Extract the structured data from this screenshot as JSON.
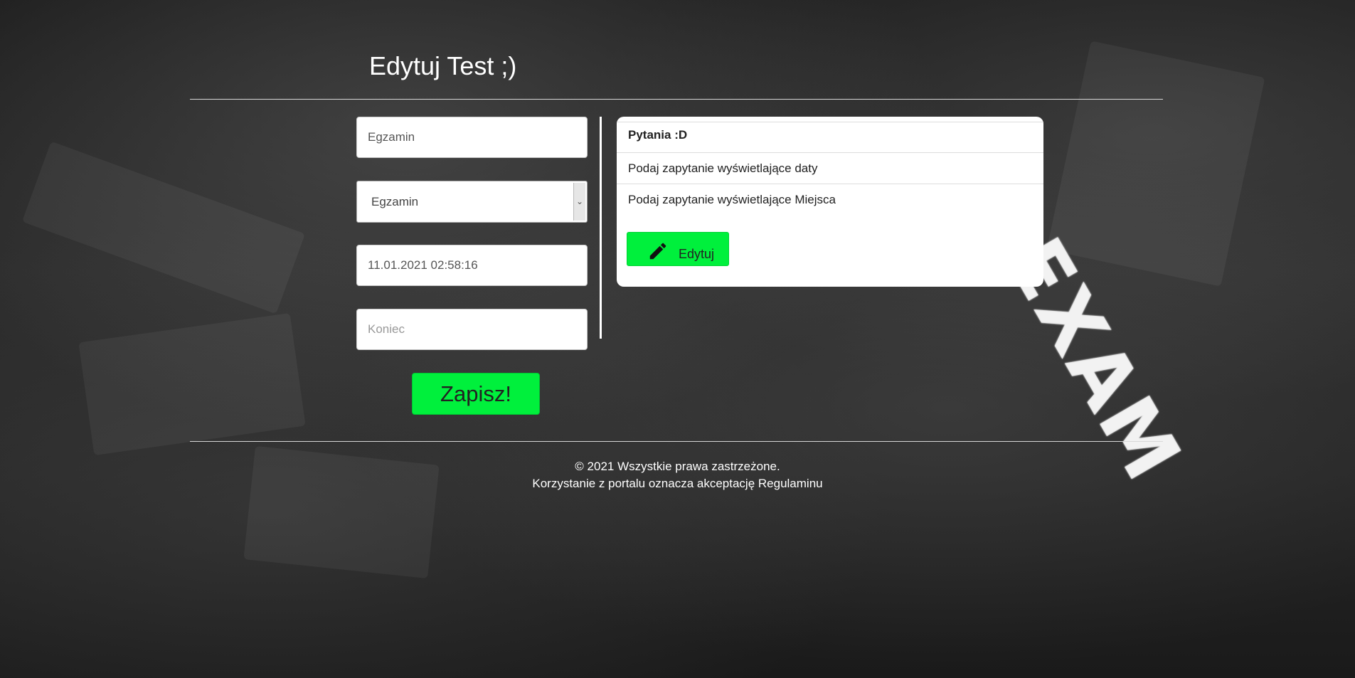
{
  "page": {
    "title": "Edytuj Test ;)"
  },
  "form": {
    "name_value": "Egzamin",
    "category_selected": "Egzamin",
    "start_value": "11.01.2021 02:58:16",
    "end_placeholder": "Koniec",
    "save_label": "Zapisz!"
  },
  "questions": {
    "header": "Pytania :D",
    "items": [
      "Podaj zapytanie wyświetlające daty",
      "Podaj zapytanie wyświetlające Miejsca"
    ],
    "edit_label": "Edytuj",
    "edit_icon": "pencil-icon"
  },
  "background": {
    "art_text": "EXAM"
  },
  "footer": {
    "copyright": "© 2021 Wszystkie prawa zastrzeżone.",
    "terms": "Korzystanie z portalu oznacza akceptację Regulaminu"
  },
  "colors": {
    "accent": "#00f03c",
    "text_light": "#ffffff",
    "panel_bg": "#ffffff"
  }
}
